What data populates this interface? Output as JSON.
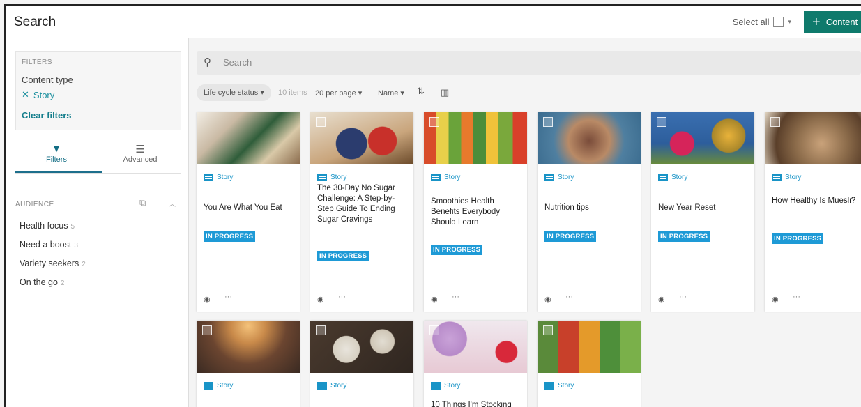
{
  "header": {
    "title": "Search",
    "select_all": "Select all",
    "content_button": "Content"
  },
  "filters": {
    "heading": "FILTERS",
    "content_type_label": "Content type",
    "active_filter": "Story",
    "clear": "Clear filters"
  },
  "tabs": [
    {
      "label": "Filters"
    },
    {
      "label": "Advanced"
    }
  ],
  "audience": {
    "heading": "AUDIENCE",
    "items": [
      {
        "label": "Health focus",
        "count": "5"
      },
      {
        "label": "Need a boost",
        "count": "3"
      },
      {
        "label": "Variety seekers",
        "count": "2"
      },
      {
        "label": "On the go",
        "count": "2"
      }
    ]
  },
  "search": {
    "placeholder": "Search"
  },
  "toolbar": {
    "lifecycle": "Life cycle status",
    "items_count": "10 items",
    "per_page": "20 per page",
    "sort": "Name"
  },
  "cards": [
    {
      "type": "Story",
      "title": "You Are What You Eat",
      "status": "IN PROGRESS"
    },
    {
      "type": "Story",
      "title": "The 30-Day No Sugar Challenge: A Step-by-Step Guide To Ending Sugar Cravings",
      "status": "IN PROGRESS"
    },
    {
      "type": "Story",
      "title": "Smoothies Health Benefits Everybody Should Learn",
      "status": "IN PROGRESS"
    },
    {
      "type": "Story",
      "title": "Nutrition tips",
      "status": "IN PROGRESS"
    },
    {
      "type": "Story",
      "title": "New Year Reset",
      "status": "IN PROGRESS"
    },
    {
      "type": "Story",
      "title": "How Healthy Is Muesli?",
      "status": "IN PROGRESS"
    },
    {
      "type": "Story",
      "title": "",
      "status": ""
    },
    {
      "type": "Story",
      "title": "",
      "status": ""
    },
    {
      "type": "Story",
      "title": "10 Things I'm Stocking",
      "status": ""
    },
    {
      "type": "Story",
      "title": "",
      "status": ""
    }
  ],
  "colors": {
    "accent": "#0f7a6c",
    "status": "#1e9ad6",
    "link": "#1994c7"
  }
}
